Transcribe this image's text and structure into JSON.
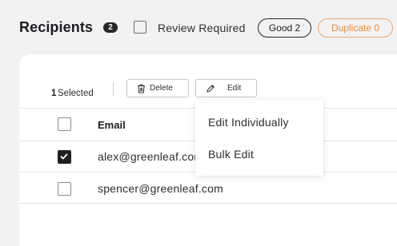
{
  "header": {
    "title": "Recipients",
    "count_badge": "2",
    "review_required_label": "Review Required",
    "review_required_checked": false,
    "good_pill": "Good 2",
    "duplicate_pill": "Duplicate 0"
  },
  "toolbar": {
    "selected_count": "1",
    "selected_label": "Selected",
    "delete_label": "Delete",
    "edit_label": "Edit"
  },
  "table": {
    "columns": [
      "Email"
    ],
    "rows": [
      {
        "email": "alex@greenleaf.com",
        "checked": true
      },
      {
        "email": "spencer@greenleaf.com",
        "checked": false
      }
    ]
  },
  "edit_menu": {
    "items": [
      {
        "label": "Edit Individually"
      },
      {
        "label": "Bulk Edit"
      }
    ]
  },
  "colors": {
    "accent_dark": "#26262b",
    "duplicate_orange": "#e88d3d",
    "background": "#f2f2f3"
  },
  "icons": {
    "delete": "trash-icon",
    "edit": "pencil-icon",
    "checked": "checkmark-icon"
  }
}
